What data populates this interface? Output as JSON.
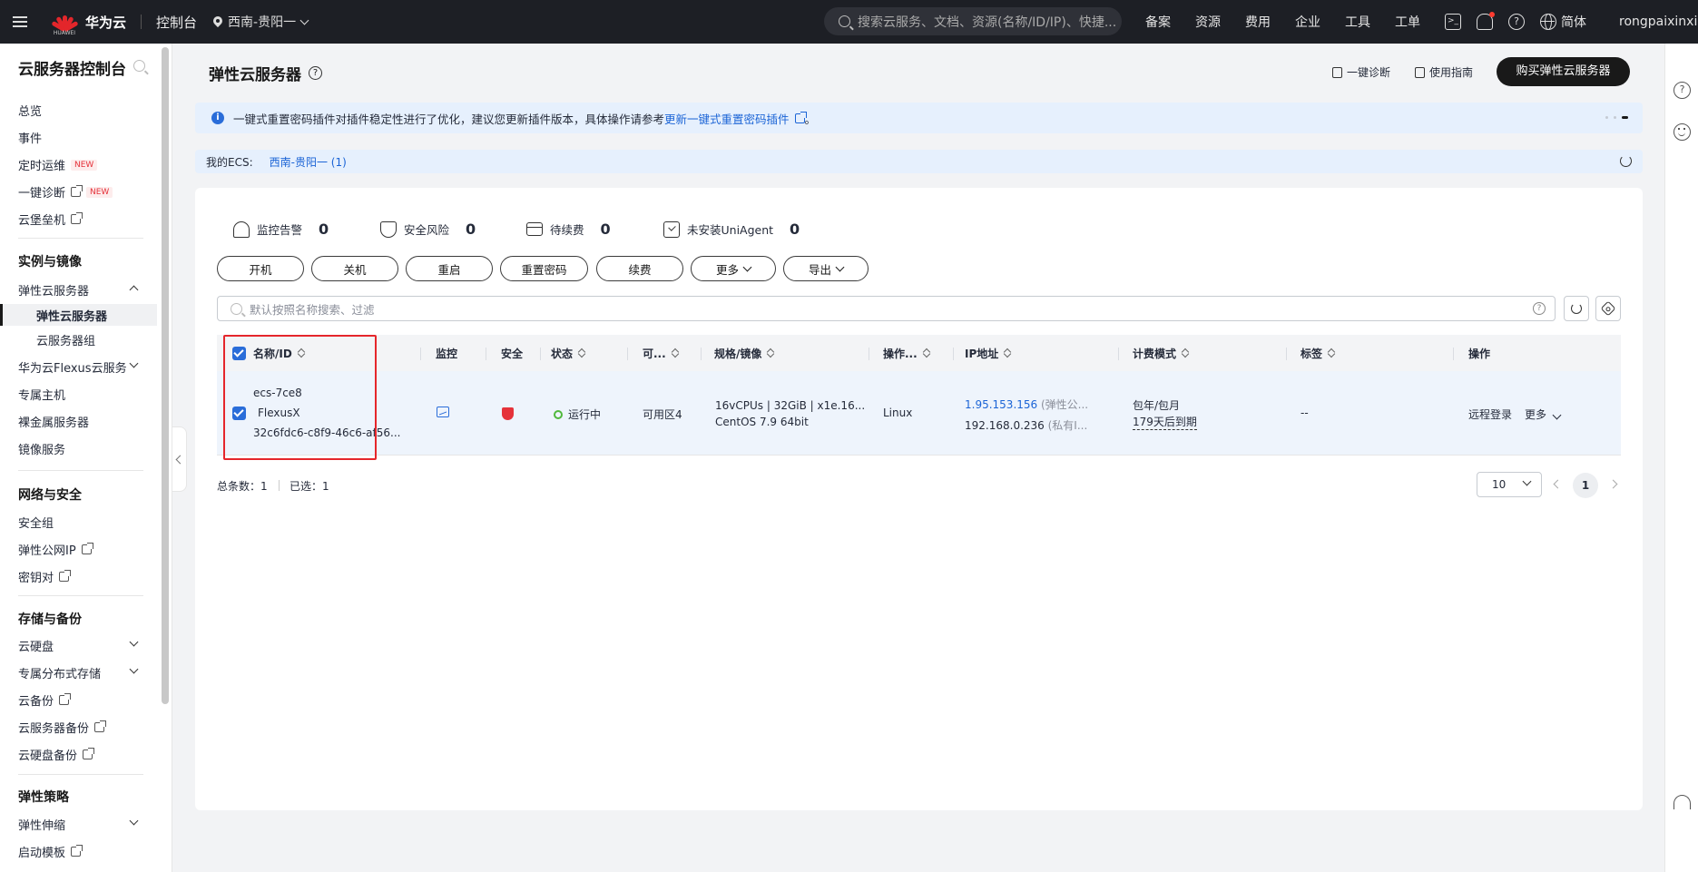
{
  "topbar": {
    "brand": "华为云",
    "brand_sub": "HUAWEI",
    "console": "控制台",
    "region": "西南-贵阳一",
    "search_placeholder": "搜索云服务、文档、资源(名称/ID/IP)、快捷...",
    "links": [
      "备案",
      "资源",
      "费用",
      "企业",
      "工具",
      "工单"
    ],
    "language": "简体",
    "user": "rongpaixinxi"
  },
  "sidebar": {
    "title": "云服务器控制台",
    "top_items": [
      {
        "label": "总览"
      },
      {
        "label": "事件"
      },
      {
        "label": "定时运维",
        "badge": "NEW"
      },
      {
        "label": "一键诊断",
        "badge": "NEW"
      },
      {
        "label": "云堡垒机"
      }
    ],
    "group1": {
      "title": "实例与镜像",
      "items": [
        "弹性云服务器",
        "弹性云服务器",
        "云服务器组",
        "华为云Flexus云服务",
        "专属主机",
        "裸金属服务器",
        "镜像服务"
      ]
    },
    "group2": {
      "title": "网络与安全",
      "items": [
        "安全组",
        "弹性公网IP",
        "密钥对"
      ]
    },
    "group3": {
      "title": "存储与备份",
      "items": [
        "云硬盘",
        "专属分布式存储",
        "云备份",
        "云服务器备份",
        "云硬盘备份"
      ]
    },
    "group4": {
      "title": "弹性策略",
      "items": [
        "弹性伸缩",
        "启动模板"
      ]
    }
  },
  "page": {
    "title": "弹性云服务器",
    "diagnose": "一键诊断",
    "guide": "使用指南",
    "buy_button": "购买弹性云服务器"
  },
  "notice": {
    "text": "一键式重置密码插件对插件稳定性进行了优化，建议您更新插件版本，具体操作请参考",
    "link": "更新一键式重置密码插件",
    "end": "。"
  },
  "my_ecs": {
    "label": "我的ECS:",
    "region_link": "西南-贵阳一 (1)"
  },
  "stats": [
    {
      "label": "监控告警",
      "value": "0",
      "icon": "alarm-icon"
    },
    {
      "label": "安全风险",
      "value": "0",
      "icon": "shield-icon"
    },
    {
      "label": "待续费",
      "value": "0",
      "icon": "card-icon"
    },
    {
      "label": "未安装UniAgent",
      "value": "0",
      "icon": "download-icon"
    }
  ],
  "actions": [
    "开机",
    "关机",
    "重启",
    "重置密码",
    "续费",
    "更多",
    "导出"
  ],
  "search": {
    "placeholder": "默认按照名称搜索、过滤"
  },
  "table": {
    "columns": [
      "名称/ID",
      "监控",
      "安全",
      "状态",
      "可...",
      "规格/镜像",
      "操作...",
      "IP地址",
      "计费模式",
      "标签",
      "操作"
    ],
    "rows": [
      {
        "name": "ecs-7ce8",
        "type": "FlexusX",
        "id": "32c6fdc6-c8f9-46c6-af56...",
        "status": "运行中",
        "az": "可用区4",
        "spec": "16vCPUs | 32GiB | x1e.16...",
        "image": "CentOS 7.9 64bit",
        "os": "Linux",
        "public_ip": "1.95.153.156",
        "public_ip_note": "(弹性公...",
        "private_ip": "192.168.0.236",
        "private_ip_note": "(私有I...",
        "billing": "包年/包月",
        "expiry": "179天后到期",
        "tag": "--",
        "remote_login": "远程登录",
        "more": "更多"
      }
    ]
  },
  "footer": {
    "total_label": "总条数：",
    "total": "1",
    "selected_label": "已选：",
    "selected": "1",
    "page_size": "10",
    "current_page": "1"
  },
  "colors": {
    "accent": "#1b64d6",
    "topbar": "#1d1f25",
    "highlight_box": "#e5262b",
    "running": "#50b83c"
  }
}
